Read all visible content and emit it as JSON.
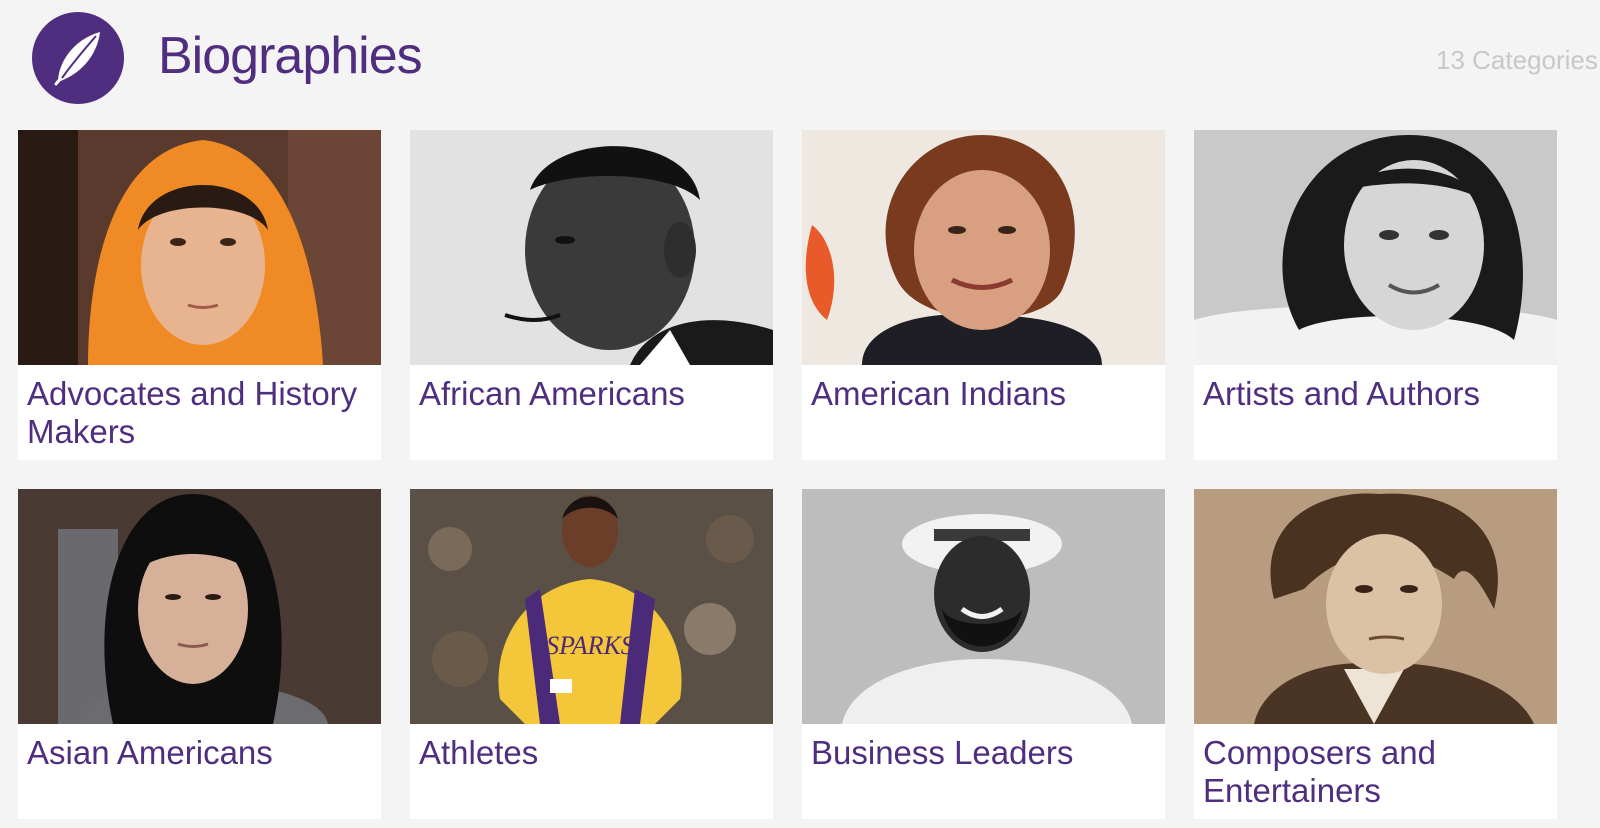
{
  "header": {
    "logo_icon": "feather-icon",
    "title": "Biographies",
    "count": "13 Categories"
  },
  "colors": {
    "brand_purple": "#4f2d7f",
    "background": "#f4f4f4",
    "count_gray": "#c8c8c8"
  },
  "categories": [
    {
      "label": "Advocates and History Makers",
      "image": "portrait-orange-headscarf"
    },
    {
      "label": "African Americans",
      "image": "portrait-bw-man-suit"
    },
    {
      "label": "American Indians",
      "image": "portrait-woman-red-hair"
    },
    {
      "label": "Artists and Authors",
      "image": "portrait-bw-girl"
    },
    {
      "label": "Asian Americans",
      "image": "portrait-woman-black-hair"
    },
    {
      "label": "Athletes",
      "image": "photo-basketball-player"
    },
    {
      "label": "Business Leaders",
      "image": "portrait-bw-man-hat"
    },
    {
      "label": "Composers and Entertainers",
      "image": "portrait-sepia-composer"
    }
  ]
}
